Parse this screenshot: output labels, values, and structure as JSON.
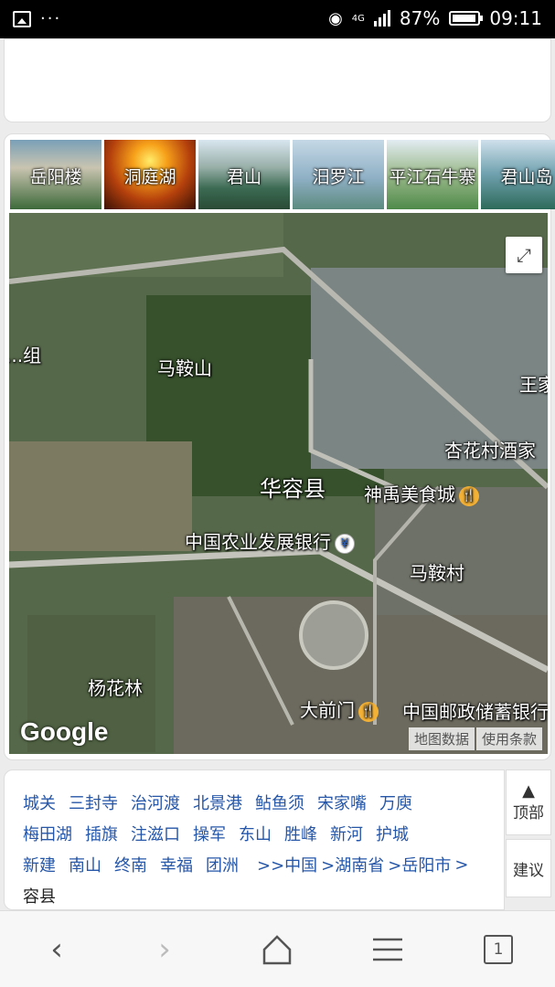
{
  "status_bar": {
    "network": "4G",
    "battery": "87%",
    "time": "09:11"
  },
  "thumbnails": [
    {
      "label": "岳阳楼"
    },
    {
      "label": "洞庭湖"
    },
    {
      "label": "君山"
    },
    {
      "label": "汨罗江"
    },
    {
      "label": "平江石牛寨"
    },
    {
      "label": "君山岛"
    }
  ],
  "map": {
    "places": {
      "p0": "...组",
      "p1": "马鞍山",
      "p2": "王家",
      "p3": "杏花村酒家",
      "p4": "华容县",
      "p5": "神禹美食城",
      "p6": "中国农业发展银行",
      "p7": "马鞍村",
      "p8": "杨花林",
      "p9": "大前门",
      "p10": "中国邮政储蓄银行"
    },
    "brand": "Google",
    "attribution": {
      "data": "地图数据",
      "terms": "使用条款"
    }
  },
  "links": {
    "row1": [
      "城关",
      "三封寺",
      "治河渡",
      "北景港",
      "鲇鱼须",
      "宋家嘴",
      "万庾"
    ],
    "row2": [
      "梅田湖",
      "插旗",
      "注滋口",
      "操军",
      "东山",
      "胜峰",
      "新河",
      "护城"
    ],
    "row3": [
      "新建",
      "南山",
      "终南",
      "幸福",
      "团洲"
    ],
    "breadcrumb": [
      ">>中国",
      ">湖南省",
      ">岳阳市",
      ">"
    ],
    "tail": "容县"
  },
  "side_buttons": {
    "top_arrow": "▲",
    "top": "顶部",
    "suggest": "建议"
  },
  "nav": {
    "back": "‹",
    "forward": "›",
    "tabs": "1"
  }
}
